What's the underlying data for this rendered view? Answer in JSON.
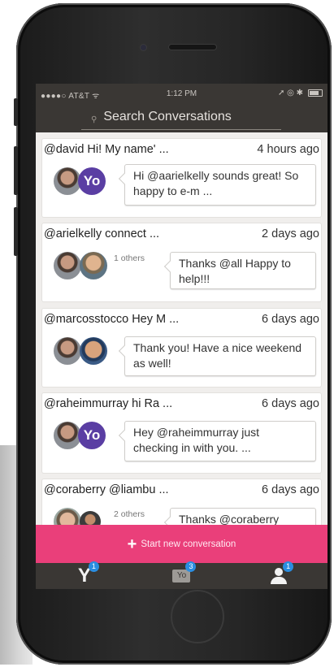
{
  "status_bar": {
    "carrier": "●●●●○ AT&T ᯤ",
    "time": "1:12 PM",
    "indicators": "➚ ◎ ✱"
  },
  "search": {
    "placeholder": "Search Conversations"
  },
  "conversations": [
    {
      "subject": "@david Hi! My name' ...",
      "time": "4 hours ago",
      "preview": "Hi @aarielkelly sounds great! So happy to e-m ...",
      "others": ""
    },
    {
      "subject": "@arielkelly connect ...",
      "time": "2 days ago",
      "preview": "Thanks @all Happy to help!!!",
      "others": "1 others"
    },
    {
      "subject": "@marcosstocco Hey M ...",
      "time": "6 days ago",
      "preview": "Thank you! Have a nice weekend as well!",
      "others": ""
    },
    {
      "subject": "@raheimmurray hi Ra ...",
      "time": "6 days ago",
      "preview": "Hey @raheimmurray just checking in with you. ...",
      "others": ""
    },
    {
      "subject": "@coraberry @liambu ...",
      "time": "6 days ago",
      "preview": "Thanks @coraberry",
      "others": "2 others"
    }
  ],
  "new_conversation": {
    "icon": "+",
    "label": "Start new conversation"
  },
  "tabs": [
    {
      "icon": "Y",
      "name": "yo-connect",
      "badge": "1"
    },
    {
      "icon": "Yo",
      "name": "messages",
      "badge": "3"
    },
    {
      "icon": "person",
      "name": "profile",
      "badge": "1"
    }
  ],
  "colors": {
    "accent": "#ea3f7a",
    "badge": "#2a8de0",
    "dark": "#3a3734",
    "yo_purple": "#5a3ea3"
  }
}
